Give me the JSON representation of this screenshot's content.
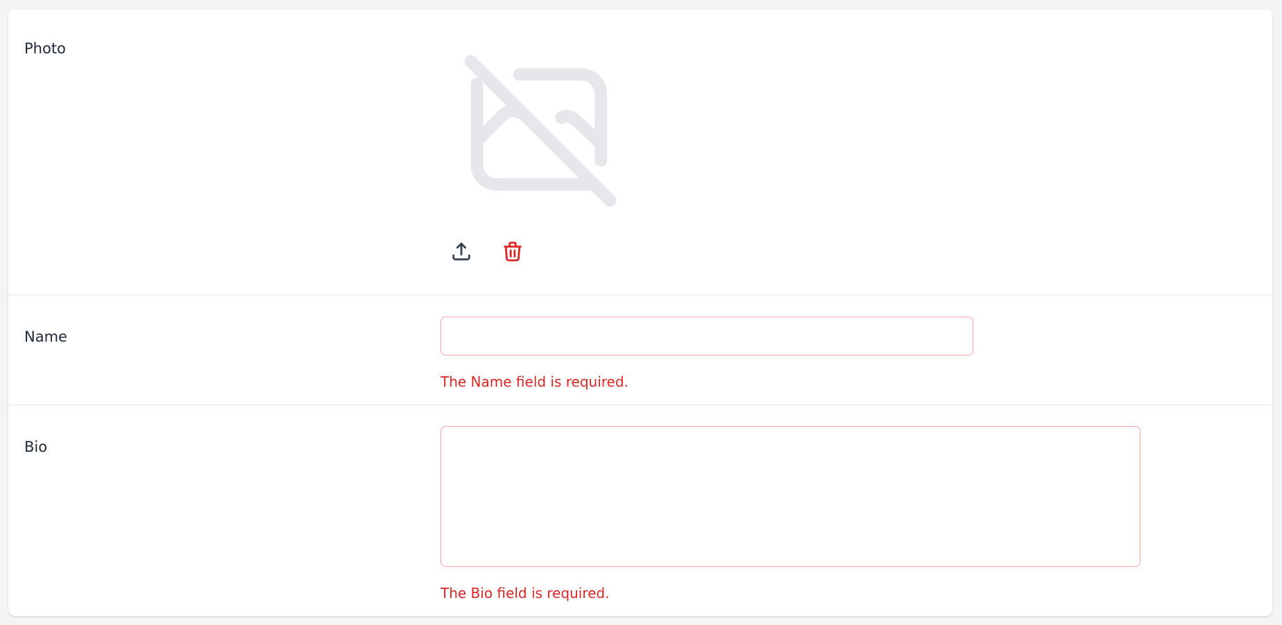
{
  "form": {
    "photo": {
      "label": "Photo",
      "placeholder_icon": "image-off-icon",
      "upload_icon": "upload-icon",
      "delete_icon": "trash-icon"
    },
    "name": {
      "label": "Name",
      "value": "",
      "error": "The Name field is required."
    },
    "bio": {
      "label": "Bio",
      "value": "",
      "error": "The Bio field is required."
    }
  },
  "colors": {
    "page_background": "#f3f4f6",
    "card_background": "#ffffff",
    "error": "#dc2626",
    "error_border": "#fca5a5",
    "placeholder_icon": "#e5e7eb",
    "upload_icon": "#374151",
    "divider": "#e5e7eb"
  }
}
